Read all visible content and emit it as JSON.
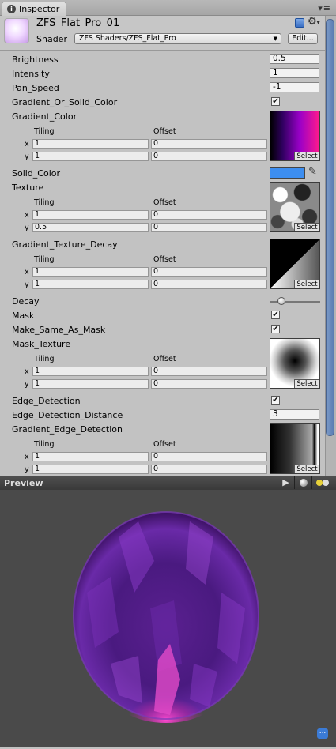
{
  "tab": {
    "title": "Inspector"
  },
  "header": {
    "material_name": "ZFS_Flat_Pro_01",
    "shader_label": "Shader",
    "shader_value": "ZFS Shaders/ZFS_Flat_Pro",
    "edit_label": "Edit..."
  },
  "properties": {
    "brightness": {
      "label": "Brightness",
      "value": "0.5"
    },
    "intensity": {
      "label": "Intensity",
      "value": "1"
    },
    "pan_speed": {
      "label": "Pan_Speed",
      "value": "-1"
    },
    "gradient_or_solid": {
      "label": "Gradient_Or_Solid_Color",
      "checked": "✔"
    },
    "gradient_color": {
      "label": "Gradient_Color",
      "tiling": "Tiling",
      "offset": "Offset",
      "x": "x",
      "y": "y",
      "tx": "1",
      "ty": "1",
      "ox": "0",
      "oy": "0",
      "select": "Select"
    },
    "solid_color": {
      "label": "Solid_Color",
      "color": "#3d8ef0"
    },
    "texture": {
      "label": "Texture",
      "tiling": "Tiling",
      "offset": "Offset",
      "x": "x",
      "y": "y",
      "tx": "1",
      "ty": "0.5",
      "ox": "0",
      "oy": "0",
      "select": "Select"
    },
    "gradient_texture_decay": {
      "label": "Gradient_Texture_Decay",
      "tiling": "Tiling",
      "offset": "Offset",
      "x": "x",
      "y": "y",
      "tx": "1",
      "ty": "1",
      "ox": "0",
      "oy": "0",
      "select": "Select"
    },
    "decay": {
      "label": "Decay",
      "slider_fraction": 0.18
    },
    "mask": {
      "label": "Mask",
      "checked": "✔"
    },
    "make_same_as_mask": {
      "label": "Make_Same_As_Mask",
      "checked": "✔"
    },
    "mask_texture": {
      "label": "Mask_Texture",
      "tiling": "Tiling",
      "offset": "Offset",
      "x": "x",
      "y": "y",
      "tx": "1",
      "ty": "1",
      "ox": "0",
      "oy": "0",
      "select": "Select"
    },
    "edge_detection": {
      "label": "Edge_Detection",
      "checked": "✔"
    },
    "edge_detection_distance": {
      "label": "Edge_Detection_Distance",
      "value": "3"
    },
    "gradient_edge_detection": {
      "label": "Gradient_Edge_Detection",
      "tiling": "Tiling",
      "offset": "Offset",
      "x": "x",
      "y": "y",
      "tx": "1",
      "ty": "1",
      "ox": "0",
      "oy": "0",
      "select": "Select"
    }
  },
  "preview": {
    "title": "Preview",
    "play_icon": "play-icon",
    "sphere_icon": "sphere-mesh-icon",
    "light_icon": "light-toggle-icon",
    "corner_label": "..."
  },
  "colors": {
    "accent": "#5a7cb2",
    "preview_bg": "#4a4a4a",
    "sphere_purple": "#7a2fb0",
    "sphere_magenta": "#e040c0"
  }
}
